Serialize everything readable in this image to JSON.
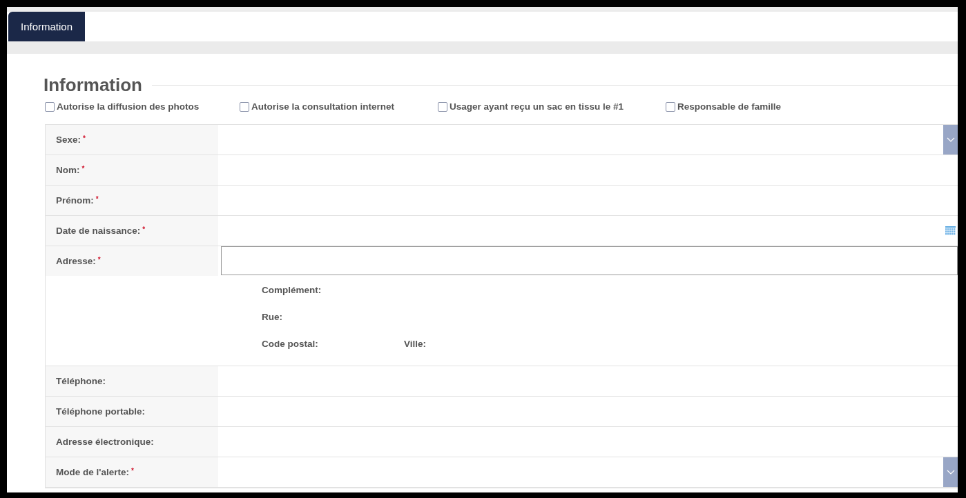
{
  "tabs": [
    {
      "label": "Information",
      "selected": true
    }
  ],
  "section": {
    "title": "Information"
  },
  "checkboxes": [
    {
      "label": "Autorise la diffusion des photos",
      "checked": false
    },
    {
      "label": "Autorise la consultation internet",
      "checked": false
    },
    {
      "label": "Usager ayant reçu un sac en tissu le #1",
      "checked": false
    },
    {
      "label": "Responsable de famille",
      "checked": false
    }
  ],
  "fields": [
    {
      "kind": "select",
      "label": "Sexe:",
      "mark": "*"
    },
    {
      "kind": "text",
      "label": "Nom:",
      "mark": "*"
    },
    {
      "kind": "text",
      "label": "Prénom:",
      "mark": "*"
    },
    {
      "kind": "date",
      "label": "Date de naissance:",
      "mark": "*"
    },
    {
      "kind": "address",
      "label": "Adresse:",
      "mark": "*",
      "sub_rows": [
        [
          "Complément:"
        ],
        [
          "Rue:"
        ],
        [
          "Code postal:",
          "Ville:"
        ]
      ]
    },
    {
      "kind": "text",
      "label": "Téléphone:"
    },
    {
      "kind": "text",
      "label": "Téléphone portable:"
    },
    {
      "kind": "text",
      "label": "Adresse électronique:"
    },
    {
      "kind": "select",
      "label": "Mode de l'alerte:",
      "mark": "*"
    }
  ]
}
